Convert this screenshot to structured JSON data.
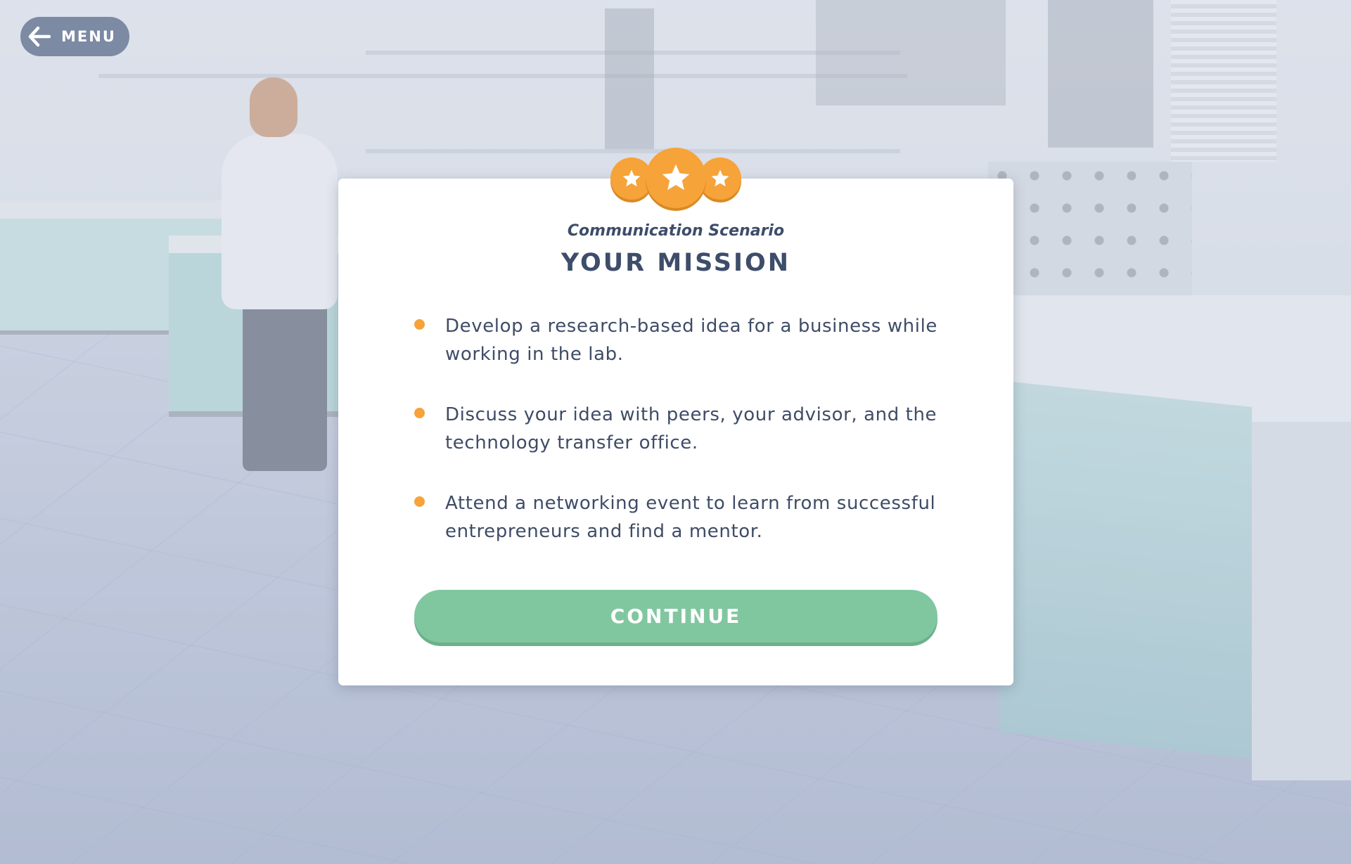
{
  "menu": {
    "label": "MENU",
    "icon": "arrow-left-icon"
  },
  "modal": {
    "rating_icon": "star-icon",
    "subtitle": "Communication Scenario",
    "title": "YOUR MISSION",
    "items": [
      {
        "text": "Develop a research-based idea for a business while working in the lab."
      },
      {
        "text": "Discuss your idea with peers, your advisor, and the technology transfer office."
      },
      {
        "text": "Attend a networking event to learn from successful entrepreneurs and find a mentor."
      }
    ],
    "continue_label": "CONTINUE"
  },
  "colors": {
    "accent": "#f6a33a",
    "primary_text": "#3d4d6a",
    "continue_button": "#80c7a0",
    "menu_button": "#7c8aa4"
  }
}
